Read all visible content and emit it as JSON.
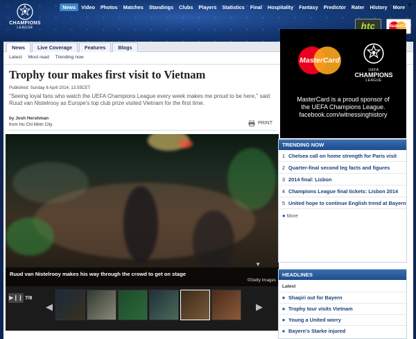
{
  "header": {
    "logo_line1": "CHAMPIONS",
    "logo_line2": "LEAGUE",
    "nav": [
      "News",
      "Video",
      "Photos",
      "Matches",
      "Standings",
      "Clubs",
      "Players",
      "Statistics",
      "Final",
      "Hospitality",
      "Fantasy",
      "Predictor",
      "Rater",
      "History",
      "More"
    ],
    "nav_active": "News",
    "sponsor_htc": "htc",
    "sponsor_mastercard": "MasterCard"
  },
  "subtabs": [
    "News",
    "Live Coverage",
    "Features",
    "Blogs"
  ],
  "filters": [
    "Latest",
    "Most read",
    "Trending now"
  ],
  "article": {
    "title": "Trophy tour makes first visit to Vietnam",
    "published": "Published: Sunday 6 April 2014, 13.55CET",
    "lead": "\"Seeing loyal fans who watch the UEFA Champions League every week makes me proud to be here,\" said Ruud van Nistelrooy as Europe's top club prize visited Vietnam for the first time.",
    "author": "by Josh Hershman",
    "location": "from Ho Chi Minh City",
    "print_label": "PRINT"
  },
  "gallery": {
    "caption": "Ruud van Nistelrooy makes his way through the crowd to get on stage",
    "credit": "©Getty Images",
    "counter": "7/8",
    "thumb_count": 6,
    "active_thumb": 4
  },
  "ad": {
    "mastercard": "MasterCard",
    "ucl_top": "UEFA",
    "ucl_mid": "CHAMPIONS",
    "ucl_bot": "LEAGUE",
    "line1": "MasterCard is a proud sponsor of",
    "line2": "the UEFA Champions League.",
    "line3": "facebook.com/witnessinghistory"
  },
  "trending": {
    "heading": "TRENDING NOW",
    "items": [
      {
        "num": "1",
        "text": "Chelsea call on home strength for Paris visit"
      },
      {
        "num": "2",
        "text": "Quarter-final second leg facts and figures"
      },
      {
        "num": "3",
        "text": "2014 final: Lisbon"
      },
      {
        "num": "4",
        "text": "Champions League final tickets: Lisbon 2014"
      },
      {
        "num": "5",
        "text": "United hope to continue English trend at Bayern"
      }
    ],
    "more": "More"
  },
  "headlines": {
    "heading": "HEADLINES",
    "latest": "Latest",
    "items": [
      "Shaqiri out for Bayern",
      "Trophy tour visits Vietnam",
      "Young a United worry",
      "Bayern's Starke injured"
    ]
  }
}
